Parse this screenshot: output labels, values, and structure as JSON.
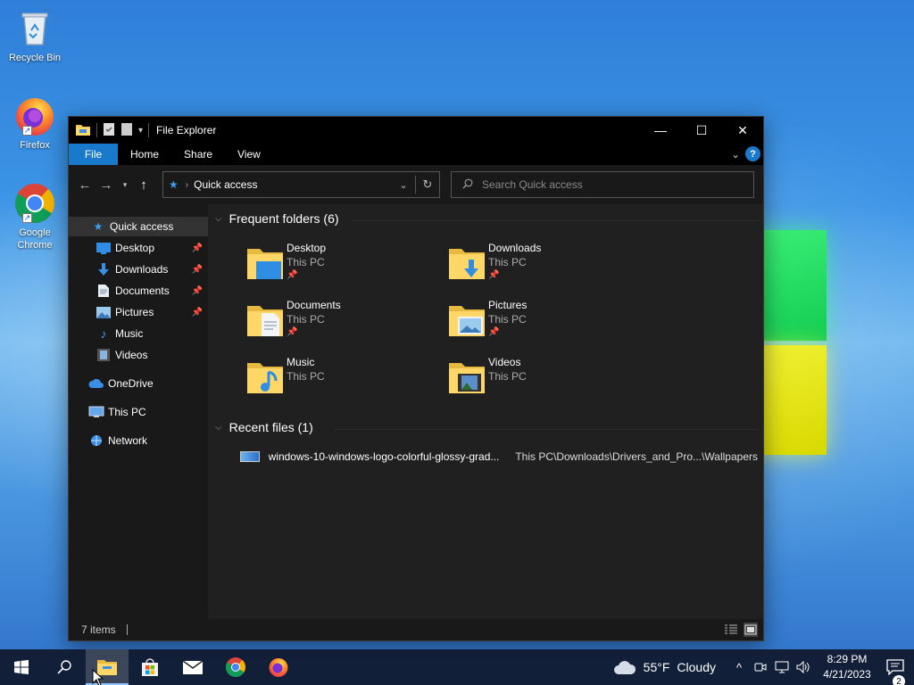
{
  "desktop": {
    "icons": [
      {
        "label": "Recycle Bin"
      },
      {
        "label": "Firefox"
      },
      {
        "label": "Google Chrome"
      }
    ]
  },
  "window": {
    "title": "File Explorer",
    "controls": {
      "minimize": "—",
      "maximize": "☐",
      "close": "✕"
    },
    "ribbon_tabs": [
      "File",
      "Home",
      "Share",
      "View"
    ],
    "address": {
      "location": "Quick access"
    },
    "search": {
      "placeholder": "Search Quick access"
    },
    "nav": [
      {
        "label": "Quick access",
        "icon": "star-icon",
        "selected": true
      },
      {
        "label": "Desktop",
        "icon": "desktop-folder-icon",
        "pinned": true
      },
      {
        "label": "Downloads",
        "icon": "downloads-icon",
        "pinned": true
      },
      {
        "label": "Documents",
        "icon": "documents-icon",
        "pinned": true
      },
      {
        "label": "Pictures",
        "icon": "pictures-icon",
        "pinned": true
      },
      {
        "label": "Music",
        "icon": "music-icon"
      },
      {
        "label": "Videos",
        "icon": "videos-icon"
      },
      {
        "label": "OneDrive",
        "icon": "cloud-icon"
      },
      {
        "label": "This PC",
        "icon": "computer-icon"
      },
      {
        "label": "Network",
        "icon": "network-icon"
      }
    ],
    "frequent": {
      "header": "Frequent folders (6)",
      "folders": [
        {
          "name": "Desktop",
          "location": "This PC",
          "pinned": true
        },
        {
          "name": "Downloads",
          "location": "This PC",
          "pinned": true
        },
        {
          "name": "Documents",
          "location": "This PC",
          "pinned": true
        },
        {
          "name": "Pictures",
          "location": "This PC",
          "pinned": true
        },
        {
          "name": "Music",
          "location": "This PC",
          "pinned": false
        },
        {
          "name": "Videos",
          "location": "This PC",
          "pinned": false
        }
      ]
    },
    "recent": {
      "header": "Recent files (1)",
      "files": [
        {
          "name": "windows-10-windows-logo-colorful-glossy-grad...",
          "path": "This PC\\Downloads\\Drivers_and_Pro...\\Wallpapers"
        }
      ]
    },
    "status": {
      "items": "7 items"
    }
  },
  "taskbar": {
    "weather": {
      "temp": "55°F",
      "condition": "Cloudy"
    },
    "clock": {
      "time": "8:29 PM",
      "date": "4/21/2023"
    },
    "notifications": "2"
  },
  "colors": {
    "accent": "#1979ca",
    "window_bg": "#202020",
    "nav_bg": "#191919"
  }
}
